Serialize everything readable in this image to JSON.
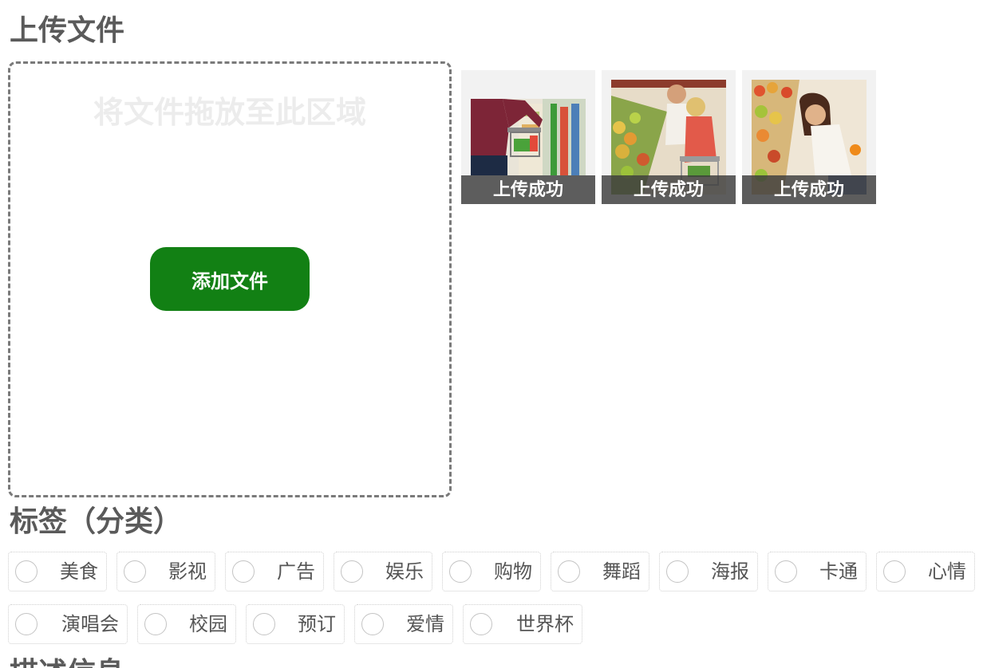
{
  "upload": {
    "title": "上传文件",
    "drop_hint": "将文件拖放至此区域",
    "add_button": "添加文件",
    "files": [
      {
        "status": "上传成功",
        "image": "shopping-cart-photo"
      },
      {
        "status": "上传成功",
        "image": "couple-shopping-photo"
      },
      {
        "status": "上传成功",
        "image": "woman-shopping-photo"
      }
    ]
  },
  "tags": {
    "title": "标签（分类）",
    "items": [
      "美食",
      "影视",
      "广告",
      "娱乐",
      "购物",
      "舞蹈",
      "海报",
      "卡通",
      "心情",
      "演唱会",
      "校园",
      "预订",
      "爱情",
      "世界杯"
    ]
  },
  "next_section": {
    "title": "描述信息"
  },
  "colors": {
    "accent": "#128014",
    "status_overlay": "#3c3c3c",
    "dashed_border": "#7a7a7a"
  }
}
